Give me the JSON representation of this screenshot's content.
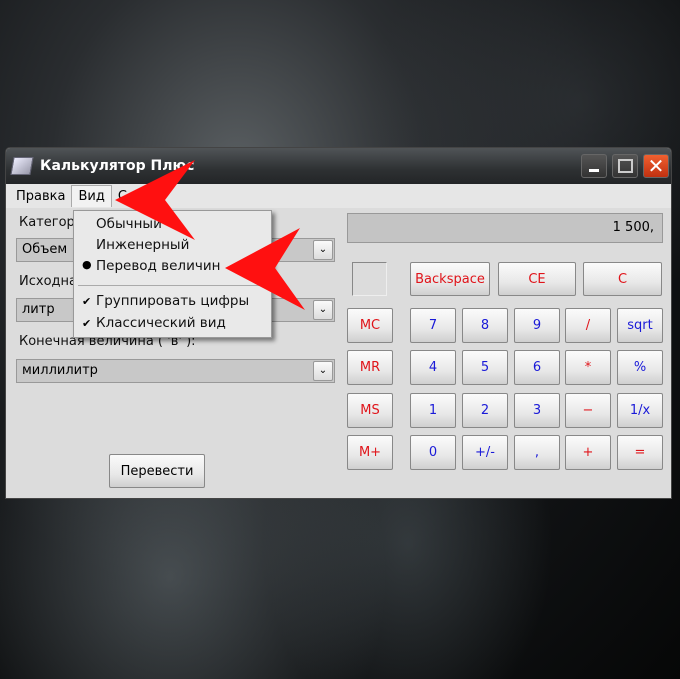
{
  "window": {
    "title": "Калькулятор Плюс"
  },
  "menubar": [
    "Правка",
    "Вид",
    "С"
  ],
  "view_menu": {
    "items": [
      {
        "label": "Обычный",
        "mark": ""
      },
      {
        "label": "Инженерный",
        "mark": ""
      },
      {
        "label": "Перевод величин",
        "mark": "●"
      },
      {
        "label": "Группировать цифры",
        "mark": "✔"
      },
      {
        "label": "Классический вид",
        "mark": "✔"
      }
    ]
  },
  "converter": {
    "category_label": "Категори",
    "category_value": "Объем",
    "source_label": "Исходна",
    "source_value": "литр",
    "target_label": "Конечная величина ( 'в' ):",
    "target_value": "миллилитр",
    "convert_button": "Перевести"
  },
  "display": {
    "value": "1 500,"
  },
  "keys": {
    "top": [
      "Backspace",
      "CE",
      "C"
    ],
    "memory": [
      "MC",
      "MR",
      "MS",
      "M+"
    ],
    "rows": [
      [
        "7",
        "8",
        "9",
        "/",
        "sqrt"
      ],
      [
        "4",
        "5",
        "6",
        "*",
        "%"
      ],
      [
        "1",
        "2",
        "3",
        "−",
        "1/x"
      ],
      [
        "0",
        "+/-",
        ",",
        "+",
        "="
      ]
    ]
  },
  "colors": {
    "red_keys": "#e0141a",
    "blue_keys": "#1a1ad8",
    "arrow": "#ff1010"
  }
}
